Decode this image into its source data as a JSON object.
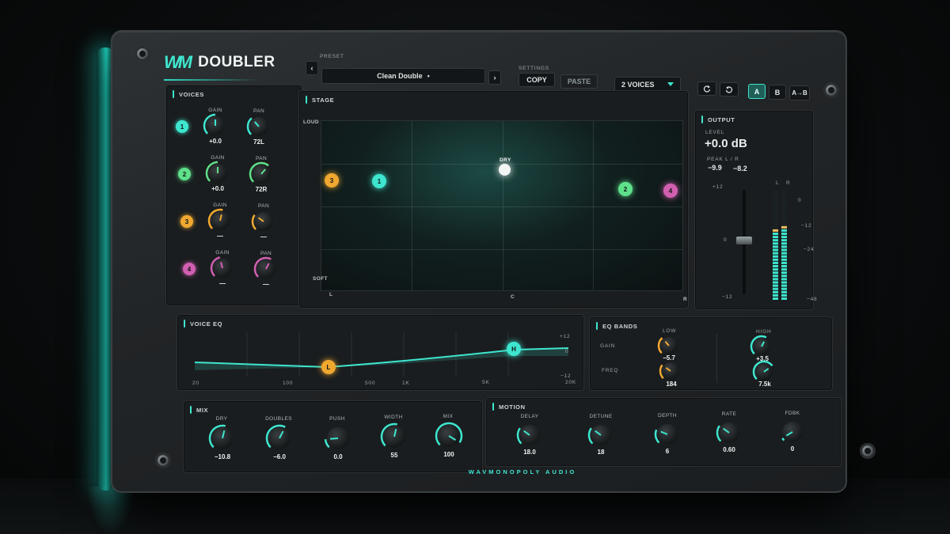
{
  "app": {
    "logo_mark": "WM",
    "name": "DOUBLER",
    "brand": "WAVMONOPOLY AUDIO"
  },
  "header": {
    "preset_label": "PRESET",
    "preset_name": "Clean Double",
    "preset_dirty_dot": "•",
    "prev_icon": "‹",
    "next_icon": "›",
    "settings_label": "SETTINGS",
    "copy": "COPY",
    "paste": "PASTE",
    "voices_select": "2 VOICES",
    "undo_icon": "undo-icon",
    "redo_icon": "redo-icon",
    "a": "A",
    "b": "B",
    "a_to_b": "A→B"
  },
  "voices": {
    "title": "VOICES",
    "gain_label": "GAIN",
    "pan_label": "PAN",
    "rows": [
      {
        "id": "1",
        "color": "#3ee6cf",
        "gain": "+0.0",
        "pan": "72L",
        "gain_level": 0.5,
        "pan_level": 0.35
      },
      {
        "id": "2",
        "color": "#5fe08a",
        "gain": "+0.0",
        "pan": "72R",
        "gain_level": 0.5,
        "pan_level": 0.65
      },
      {
        "id": "3",
        "color": "#f0a830",
        "gain": "—",
        "pan": "—",
        "gain_level": 0.55,
        "pan_level": 0.3
      },
      {
        "id": "4",
        "color": "#d15fb0",
        "gain": "—",
        "pan": "—",
        "gain_level": 0.45,
        "pan_level": 0.6
      }
    ]
  },
  "stage": {
    "title": "STAGE",
    "y_top": "LOUD",
    "y_bottom": "SOFT",
    "x_left": "L",
    "x_center": "C",
    "x_right": "R",
    "dry_label": "DRY"
  },
  "output": {
    "title": "OUTPUT",
    "level_label": "LEVEL",
    "level": "+0.0 dB",
    "peak_label": "PEAK L / R",
    "peak_l": "−9.9",
    "peak_r": "−8.2",
    "fader_top": "+12",
    "fader_mid": "0",
    "fader_bottom": "−12",
    "meter_l": "L",
    "meter_r": "R",
    "scale": [
      "0",
      "−12",
      "−24",
      "−48"
    ],
    "meter_l_level": 0.62,
    "meter_r_level": 0.66
  },
  "voice_eq": {
    "title": "VOICE EQ",
    "x_ticks": [
      "20",
      "100",
      "500",
      "1k",
      "5k",
      "20k"
    ],
    "y_top": "+12",
    "y_mid": "0",
    "y_bottom": "−12",
    "low_node": "L",
    "high_node": "H"
  },
  "eq_bands": {
    "title": "EQ BANDS",
    "low": "LOW",
    "high": "HIGH",
    "gain_label": "GAIN",
    "freq_label": "FREQ",
    "low_gain": "−5.7",
    "low_freq": "184",
    "high_gain": "+3.5",
    "high_freq": "7.5k"
  },
  "mix": {
    "title": "MIX",
    "knobs": [
      {
        "label": "DRY",
        "value": "−10.8",
        "level": 0.55
      },
      {
        "label": "DOUBLES",
        "value": "−6.0",
        "level": 0.6
      },
      {
        "label": "PUSH",
        "value": "0.0",
        "level": 0.15
      },
      {
        "label": "WIDTH",
        "value": "55",
        "level": 0.55
      },
      {
        "label": "MIX",
        "value": "100",
        "level": 0.95
      }
    ]
  },
  "motion": {
    "title": "MOTION",
    "knobs": [
      {
        "label": "DELAY",
        "value": "18.0",
        "level": 0.3
      },
      {
        "label": "DETUNE",
        "value": "18",
        "level": 0.3
      },
      {
        "label": "DEPTH",
        "value": "6",
        "level": 0.25
      },
      {
        "label": "RATE",
        "value": "0.60",
        "level": 0.3
      },
      {
        "label": "FDBK",
        "value": "0",
        "level": 0.05
      }
    ]
  },
  "colors": {
    "accent": "#3ee6cf",
    "orange": "#f0a830",
    "green": "#5fe08a",
    "pink": "#d15fb0"
  }
}
